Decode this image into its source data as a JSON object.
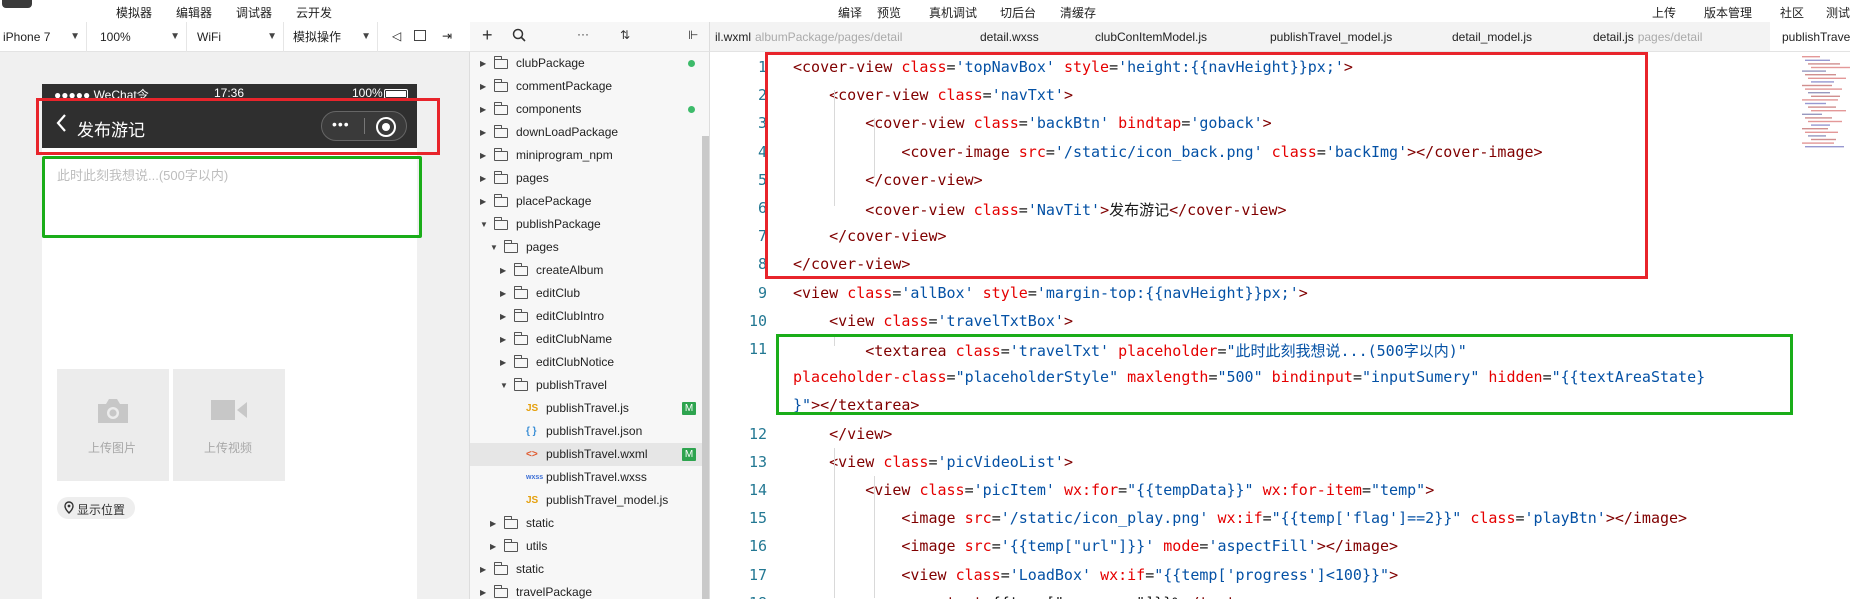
{
  "menubar": {
    "items": [
      "模拟器",
      "编辑器",
      "调试器",
      "云开发"
    ],
    "center_items": [
      "编译",
      "预览",
      "真机调试",
      "切后台",
      "清缓存"
    ],
    "right_items": [
      "上传",
      "版本管理",
      "社区",
      "测试"
    ]
  },
  "sim_toolbar": {
    "device": "iPhone 7",
    "zoom": "100%",
    "network": "WiFi",
    "mode": "模拟操作"
  },
  "phone": {
    "carrier": "●●●●● WeChat令",
    "time": "17:36",
    "battery": "100%",
    "nav_title": "发布游记",
    "textarea_placeholder": "此时此刻我想说...(500字以内)",
    "upload_photo": "上传图片",
    "upload_video": "上传视频",
    "location": "显示位置"
  },
  "explorer": {
    "items": [
      {
        "label": "clubPackage",
        "depth": 0,
        "type": "folder",
        "open": false,
        "dot": true
      },
      {
        "label": "commentPackage",
        "depth": 0,
        "type": "folder",
        "open": false
      },
      {
        "label": "components",
        "depth": 0,
        "type": "folder",
        "open": false,
        "dot": true
      },
      {
        "label": "downLoadPackage",
        "depth": 0,
        "type": "folder",
        "open": false
      },
      {
        "label": "miniprogram_npm",
        "depth": 0,
        "type": "folder",
        "open": false
      },
      {
        "label": "pages",
        "depth": 0,
        "type": "folder",
        "open": false
      },
      {
        "label": "placePackage",
        "depth": 0,
        "type": "folder",
        "open": false
      },
      {
        "label": "publishPackage",
        "depth": 0,
        "type": "folder",
        "open": true
      },
      {
        "label": "pages",
        "depth": 1,
        "type": "folder",
        "open": true
      },
      {
        "label": "createAlbum",
        "depth": 2,
        "type": "folder",
        "open": false
      },
      {
        "label": "editClub",
        "depth": 2,
        "type": "folder",
        "open": false
      },
      {
        "label": "editClubIntro",
        "depth": 2,
        "type": "folder",
        "open": false
      },
      {
        "label": "editClubName",
        "depth": 2,
        "type": "folder",
        "open": false
      },
      {
        "label": "editClubNotice",
        "depth": 2,
        "type": "folder",
        "open": false
      },
      {
        "label": "publishTravel",
        "depth": 2,
        "type": "folder",
        "open": true
      },
      {
        "label": "publishTravel.js",
        "depth": 3,
        "type": "js",
        "badge": "M"
      },
      {
        "label": "publishTravel.json",
        "depth": 3,
        "type": "json"
      },
      {
        "label": "publishTravel.wxml",
        "depth": 3,
        "type": "wxml",
        "badge": "M",
        "active": true
      },
      {
        "label": "publishTravel.wxss",
        "depth": 3,
        "type": "wxss"
      },
      {
        "label": "publishTravel_model.js",
        "depth": 3,
        "type": "js"
      },
      {
        "label": "static",
        "depth": 1,
        "type": "folder",
        "open": false
      },
      {
        "label": "utils",
        "depth": 1,
        "type": "folder",
        "open": false
      },
      {
        "label": "static",
        "depth": 0,
        "type": "folder",
        "open": false
      },
      {
        "label": "travelPackage",
        "depth": 0,
        "type": "folder",
        "open": false
      }
    ]
  },
  "tabs": [
    {
      "label": "il.wxml",
      "muted": "albumPackage/pages/detail"
    },
    {
      "label": "detail.wxss",
      "muted": ""
    },
    {
      "label": "clubConItemModel.js",
      "muted": ""
    },
    {
      "label": "publishTravel_model.js",
      "muted": ""
    },
    {
      "label": "detail_model.js",
      "muted": ""
    },
    {
      "label": "detail.js",
      "muted": "pages/detail"
    },
    {
      "label": "publishTravel.",
      "muted": "",
      "active": true
    }
  ],
  "code": {
    "line_numbers": [
      "1",
      "2",
      "3",
      "4",
      "5",
      "6",
      "7",
      "8",
      "9",
      "10",
      "11",
      "",
      "",
      "12",
      "13",
      "14",
      "15",
      "16",
      "17",
      "18"
    ],
    "lines": [
      [
        [
          "t",
          "<cover-view "
        ],
        [
          "a",
          "class"
        ],
        [
          "p",
          "="
        ],
        [
          "v",
          "'topNavBox'"
        ],
        [
          "p",
          " "
        ],
        [
          "a",
          "style"
        ],
        [
          "p",
          "="
        ],
        [
          "v",
          "'height:{{navHeight}}px;'"
        ],
        [
          "t",
          ">"
        ]
      ],
      [
        [
          "p",
          "    "
        ],
        [
          "t",
          "<cover-view "
        ],
        [
          "a",
          "class"
        ],
        [
          "p",
          "="
        ],
        [
          "v",
          "'navTxt'"
        ],
        [
          "t",
          ">"
        ]
      ],
      [
        [
          "p",
          "        "
        ],
        [
          "t",
          "<cover-view "
        ],
        [
          "a",
          "class"
        ],
        [
          "p",
          "="
        ],
        [
          "v",
          "'backBtn'"
        ],
        [
          "p",
          " "
        ],
        [
          "a",
          "bindtap"
        ],
        [
          "p",
          "="
        ],
        [
          "v",
          "'goback'"
        ],
        [
          "t",
          ">"
        ]
      ],
      [
        [
          "p",
          "            "
        ],
        [
          "t",
          "<cover-image "
        ],
        [
          "a",
          "src"
        ],
        [
          "p",
          "="
        ],
        [
          "v",
          "'/static/icon_back.png'"
        ],
        [
          "p",
          " "
        ],
        [
          "a",
          "class"
        ],
        [
          "p",
          "="
        ],
        [
          "v",
          "'backImg'"
        ],
        [
          "t",
          "></cover-image>"
        ]
      ],
      [
        [
          "p",
          "        "
        ],
        [
          "t",
          "</cover-view>"
        ]
      ],
      [
        [
          "p",
          "        "
        ],
        [
          "t",
          "<cover-view "
        ],
        [
          "a",
          "class"
        ],
        [
          "p",
          "="
        ],
        [
          "v",
          "'NavTit'"
        ],
        [
          "t",
          ">"
        ],
        [
          "p",
          "发布游记"
        ],
        [
          "t",
          "</cover-view>"
        ]
      ],
      [
        [
          "p",
          "    "
        ],
        [
          "t",
          "</cover-view>"
        ]
      ],
      [
        [
          "t",
          "</cover-view>"
        ]
      ],
      [
        [
          "t",
          "<view "
        ],
        [
          "a",
          "class"
        ],
        [
          "p",
          "="
        ],
        [
          "v",
          "'allBox'"
        ],
        [
          "p",
          " "
        ],
        [
          "a",
          "style"
        ],
        [
          "p",
          "="
        ],
        [
          "v",
          "'margin-top:{{navHeight}}px;'"
        ],
        [
          "t",
          ">"
        ]
      ],
      [
        [
          "p",
          "    "
        ],
        [
          "t",
          "<view "
        ],
        [
          "a",
          "class"
        ],
        [
          "p",
          "="
        ],
        [
          "v",
          "'travelTxtBox'"
        ],
        [
          "t",
          ">"
        ]
      ],
      [
        [
          "p",
          "        "
        ],
        [
          "t",
          "<textarea "
        ],
        [
          "a",
          "class"
        ],
        [
          "p",
          "="
        ],
        [
          "v",
          "'travelTxt'"
        ],
        [
          "p",
          " "
        ],
        [
          "a",
          "placeholder"
        ],
        [
          "p",
          "="
        ],
        [
          "v",
          "\"此时此刻我想说...(500字以内)\""
        ]
      ],
      [
        [
          "a",
          "placeholder-class"
        ],
        [
          "p",
          "="
        ],
        [
          "v",
          "\"placeholderStyle\""
        ],
        [
          "p",
          " "
        ],
        [
          "a",
          "maxlength"
        ],
        [
          "p",
          "="
        ],
        [
          "v",
          "\"500\""
        ],
        [
          "p",
          " "
        ],
        [
          "a",
          "bindinput"
        ],
        [
          "p",
          "="
        ],
        [
          "v",
          "\"inputSumery\""
        ],
        [
          "p",
          " "
        ],
        [
          "a",
          "hidden"
        ],
        [
          "p",
          "="
        ],
        [
          "v",
          "\"{{textAreaState}"
        ]
      ],
      [
        [
          "v",
          "}\""
        ],
        [
          "t",
          "></textarea>"
        ]
      ],
      [
        [
          "p",
          "    "
        ],
        [
          "t",
          "</view>"
        ]
      ],
      [
        [
          "p",
          "    "
        ],
        [
          "t",
          "<view "
        ],
        [
          "a",
          "class"
        ],
        [
          "p",
          "="
        ],
        [
          "v",
          "'picVideoList'"
        ],
        [
          "t",
          ">"
        ]
      ],
      [
        [
          "p",
          "        "
        ],
        [
          "t",
          "<view "
        ],
        [
          "a",
          "class"
        ],
        [
          "p",
          "="
        ],
        [
          "v",
          "'picItem'"
        ],
        [
          "p",
          " "
        ],
        [
          "a",
          "wx:for"
        ],
        [
          "p",
          "="
        ],
        [
          "v",
          "\"{{tempData}}\""
        ],
        [
          "p",
          " "
        ],
        [
          "a",
          "wx:for-item"
        ],
        [
          "p",
          "="
        ],
        [
          "v",
          "\"temp\""
        ],
        [
          "t",
          ">"
        ]
      ],
      [
        [
          "p",
          "            "
        ],
        [
          "t",
          "<image "
        ],
        [
          "a",
          "src"
        ],
        [
          "p",
          "="
        ],
        [
          "v",
          "'/static/icon_play.png'"
        ],
        [
          "p",
          " "
        ],
        [
          "a",
          "wx:if"
        ],
        [
          "p",
          "="
        ],
        [
          "v",
          "\"{{temp['flag']==2}}\""
        ],
        [
          "p",
          " "
        ],
        [
          "a",
          "class"
        ],
        [
          "p",
          "="
        ],
        [
          "v",
          "'playBtn'"
        ],
        [
          "t",
          "></image>"
        ]
      ],
      [
        [
          "p",
          "            "
        ],
        [
          "t",
          "<image "
        ],
        [
          "a",
          "src"
        ],
        [
          "p",
          "="
        ],
        [
          "v",
          "'{{temp[\"url\"]}}'"
        ],
        [
          "p",
          " "
        ],
        [
          "a",
          "mode"
        ],
        [
          "p",
          "="
        ],
        [
          "v",
          "'aspectFill'"
        ],
        [
          "t",
          "></image>"
        ]
      ],
      [
        [
          "p",
          "            "
        ],
        [
          "t",
          "<view "
        ],
        [
          "a",
          "class"
        ],
        [
          "p",
          "="
        ],
        [
          "v",
          "'LoadBox'"
        ],
        [
          "p",
          " "
        ],
        [
          "a",
          "wx:if"
        ],
        [
          "p",
          "="
        ],
        [
          "v",
          "\"{{temp['progress']<100}}\""
        ],
        [
          "t",
          ">"
        ]
      ],
      [
        [
          "p",
          "                "
        ],
        [
          "t",
          "<text>"
        ],
        [
          "p",
          "{{temp[\"progress\"]}}%"
        ],
        [
          "t",
          "</text>"
        ]
      ]
    ]
  },
  "colors": {
    "highlight_red": "#e8242b",
    "highlight_green": "#1aad19",
    "tag": "#800000",
    "attr": "#e50000",
    "value": "#0451a5"
  }
}
